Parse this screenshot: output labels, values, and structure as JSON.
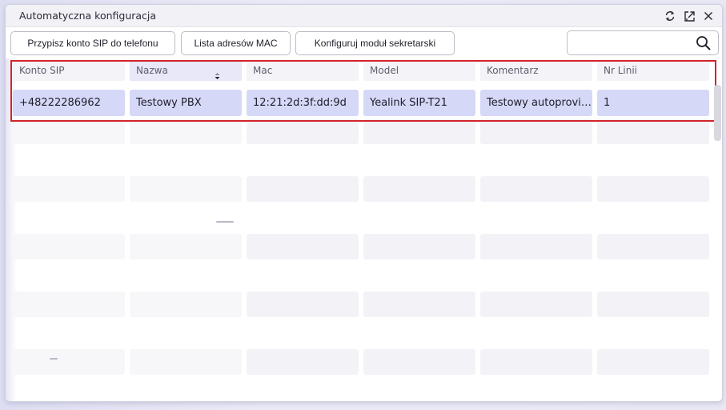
{
  "window": {
    "title": "Automatyczna konfiguracja",
    "icons": [
      "refresh-icon",
      "popout-icon",
      "close-icon"
    ]
  },
  "toolbar": {
    "assign_label": "Przypisz konto SIP do telefonu",
    "mac_list_label": "Lista adresów MAC",
    "secretary_label": "Konfiguruj moduł sekretarski",
    "search": {
      "value": "",
      "placeholder": ""
    }
  },
  "table": {
    "columns": [
      "Konto SIP",
      "Nazwa",
      "Mac",
      "Model",
      "Komentarz",
      "Nr Linii"
    ],
    "sorted_column": "Nazwa",
    "rows": [
      [
        "+48222286962",
        "Testowy PBX",
        "12:21:2d:3f:dd:9d",
        "Yealink SIP-T21",
        "Testowy autoprovisioning",
        "1"
      ]
    ]
  },
  "colors": {
    "selected_row": "#d6d8f7",
    "highlight_border": "#d3232a"
  }
}
